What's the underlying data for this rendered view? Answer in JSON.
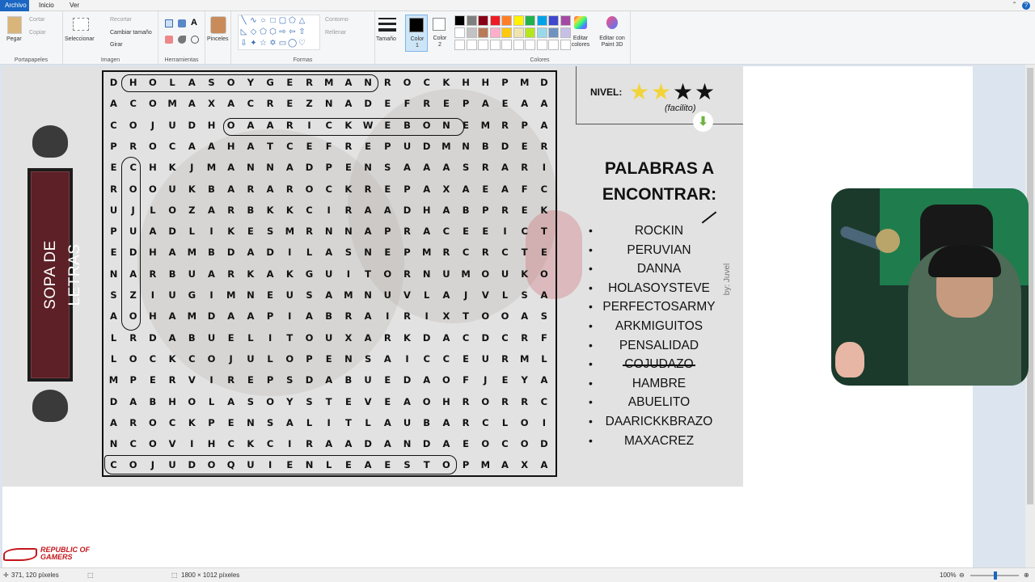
{
  "menu": {
    "tabs": [
      "Archivo",
      "Inicio",
      "Ver"
    ]
  },
  "ribbon": {
    "portapapeles": {
      "paste": "Pegar",
      "cut": "Cortar",
      "copy": "Copiar",
      "label": "Portapapeles"
    },
    "imagen": {
      "select": "Seleccionar",
      "crop": "Recortar",
      "resize": "Cambiar tamaño",
      "rotate": "Girar",
      "label": "Imagen"
    },
    "herramientas": {
      "label": "Herramientas"
    },
    "pinceles": {
      "label": "Pinceles"
    },
    "formas": {
      "outline": "Contorno",
      "fill": "Rellenar",
      "label": "Formas"
    },
    "size": {
      "label": "Tamaño"
    },
    "color1": {
      "label": "Color 1"
    },
    "color2": {
      "label": "Color 2"
    },
    "colores": {
      "label": "Colores",
      "edit": "Editar colores",
      "paint3d": "Editar con Paint 3D"
    }
  },
  "palette_top": [
    "#000000",
    "#7f7f7f",
    "#880015",
    "#ed1c24",
    "#ff7f27",
    "#fff200",
    "#22b14c",
    "#00a2e8",
    "#3f48cc",
    "#a349a4"
  ],
  "palette_bottom": [
    "#ffffff",
    "#c3c3c3",
    "#b97a57",
    "#ffaec9",
    "#ffc90e",
    "#efe4b0",
    "#b5e61d",
    "#99d9ea",
    "#7092be",
    "#c8bfe7"
  ],
  "puzzle": {
    "side_title": "SOPA DE LETRAS",
    "nivel_label": "NIVEL:",
    "nivel_stars": 2,
    "nivel_max": 4,
    "nivel_sub": "(facilito)",
    "words_title": "PALABRAS A ENCONTRAR:",
    "words": [
      "ROCKIN",
      "PERUVIAN",
      "DANNA",
      "HOLASOYSTEVE",
      "PERFECTOSARMY",
      "ARKMIGUITOS",
      "PENSALIDAD",
      "COJUDAZO",
      "HAMBRE",
      "ABUELITO",
      "DAARICKKBRAZO",
      "MAXACREZ"
    ],
    "byline": "by: Juvel",
    "grid": [
      "DHOLASOYGERMANROCKHHPMD",
      "ACOMAXACREZNADEFREPAEAA",
      "COJUDHOAARICKWEBONEMRPA",
      "PROCAAHATCEFREPUDMNBDER",
      "ECHKJMANNADPENSAAASRARI",
      "ROOUKBARAROCKREPAXAEAFC",
      "UJLOZARBKKCIRAADHABPREK",
      "PUADLIKESMRNNAPRACEEICT",
      "EDHAMBDADILASNEPMRCRCTE",
      "NARBUARKAKGUITORNUMOUKOT",
      "SZIUGIMNEUSAMNUVLAJVLSA",
      "AOHAMDAAPIABRAIRIXTOOAS",
      "LRDABUELITOUXARKDACDCRF",
      "LOCKCOJULOPENSAICCEURML",
      "MPERVIREPSDABUEDAOFJEYA",
      "DABHOLASOYSTEVEAOHRORRC",
      "AROCKPENSALITLAUBARCLOI",
      "NCOVIHCKCIRAADANDAEOCOD",
      "COJUDOQUIENLEAESTOPMAXA"
    ]
  },
  "status": {
    "coords": "371, 120 píxeles",
    "size": "1800 × 1012 píxeles",
    "zoom": "100%"
  },
  "logo": {
    "line1": "REPUBLIC OF",
    "line2": "GAMERS"
  }
}
